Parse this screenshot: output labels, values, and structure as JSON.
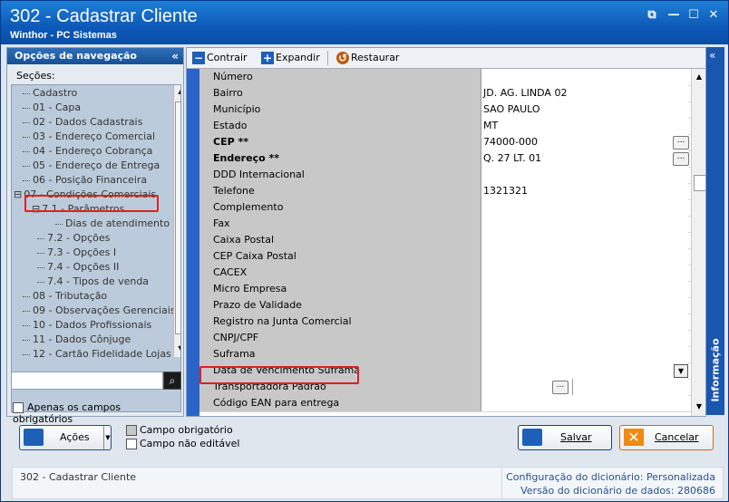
{
  "window": {
    "title": "302 - Cadastrar Cliente",
    "subtitle": "Winthor - PC Sistemas",
    "controls": {
      "restore": "⧉",
      "minimize": "—",
      "maximize": "☐",
      "close": "✕"
    }
  },
  "nav": {
    "header": "Opções de navegação",
    "collapse_glyph": "«",
    "secoes_label": "Seções:",
    "items": [
      {
        "label": "Cadastro"
      },
      {
        "label": "01 - Capa"
      },
      {
        "label": "02 - Dados Cadastrais"
      },
      {
        "label": "03 - Endereço Comercial"
      },
      {
        "label": "04 - Endereço Cobrança"
      },
      {
        "label": "05 - Endereço de Entrega"
      },
      {
        "label": "06 - Posição Financeira"
      },
      {
        "label": "07 - Condições Comerciais"
      },
      {
        "label": "7.1 - Parâmetros"
      },
      {
        "label": "Dias de atendimento"
      },
      {
        "label": "7.2 - Opções"
      },
      {
        "label": "7.3 - Opções I"
      },
      {
        "label": "7.4 - Opções II"
      },
      {
        "label": "7.4 - Tipos de venda"
      },
      {
        "label": "08 - Tributação"
      },
      {
        "label": "09 - Observações Gerenciais"
      },
      {
        "label": "10 - Dados Profissionais"
      },
      {
        "label": "11 - Dados Cônjuge"
      },
      {
        "label": "12 - Cartão Fidelidade Lojas"
      }
    ],
    "search_value": "",
    "apenas_label": "Apenas os campos obrigatórios"
  },
  "toolbar": {
    "contrair": "Contrair",
    "expandir": "Expandir",
    "restaurar": "Restaurar"
  },
  "grid": {
    "rows": [
      {
        "label": "Número",
        "value": ""
      },
      {
        "label": "Bairro",
        "value": "JD. AG. LINDA 02"
      },
      {
        "label": "Município",
        "value": "SAO PAULO"
      },
      {
        "label": "Estado",
        "value": "MT"
      },
      {
        "label": "CEP **",
        "value": "74000-000",
        "bold": true,
        "button": "ellipsis"
      },
      {
        "label": "Endereço **",
        "value": "Q. 27 LT. 01",
        "bold": true,
        "button": "ellipsis"
      },
      {
        "label": "DDD Internacional",
        "value": ""
      },
      {
        "label": "Telefone",
        "value": "1321321"
      },
      {
        "label": "Complemento",
        "value": ""
      },
      {
        "label": "Fax",
        "value": ""
      },
      {
        "label": "Caixa Postal",
        "value": ""
      },
      {
        "label": "CEP Caixa Postal",
        "value": ""
      },
      {
        "label": "CACEX",
        "value": ""
      },
      {
        "label": "Micro Empresa",
        "value": ""
      },
      {
        "label": "Prazo de Validade",
        "value": ""
      },
      {
        "label": "Registro na Junta Comercial",
        "value": ""
      },
      {
        "label": "CNPJ/CPF",
        "value": ""
      },
      {
        "label": "Suframa",
        "value": ""
      },
      {
        "label": "Data de Vencimento Suframa",
        "value": "",
        "button": "dropdown"
      },
      {
        "label": "Transportadora Padrão",
        "value": "",
        "button": "ellipsis-mid"
      },
      {
        "label": "Código EAN para entrega",
        "value": ""
      }
    ],
    "ellipsis_glyph": "...",
    "dropdown_glyph": "▼"
  },
  "info_panel": {
    "label": "Informação",
    "collapse_glyph": "«"
  },
  "bottom": {
    "acoes": "Ações",
    "legend_obrigatorio": "Campo obrigatório",
    "legend_nao_editavel": "Campo não editável",
    "salvar": "Salvar",
    "cancelar": "Cancelar"
  },
  "status": {
    "left": "302 - Cadastrar Cliente",
    "config_label": "Configuração do dicionário:",
    "config_value": "Personalizada",
    "versao_label": "Versão do dicionário de dados:",
    "versao_value": "280686"
  },
  "colors": {
    "title_bar": "#0d59b8",
    "highlight": "#e02020",
    "blue_strip": "#2a64c8"
  }
}
